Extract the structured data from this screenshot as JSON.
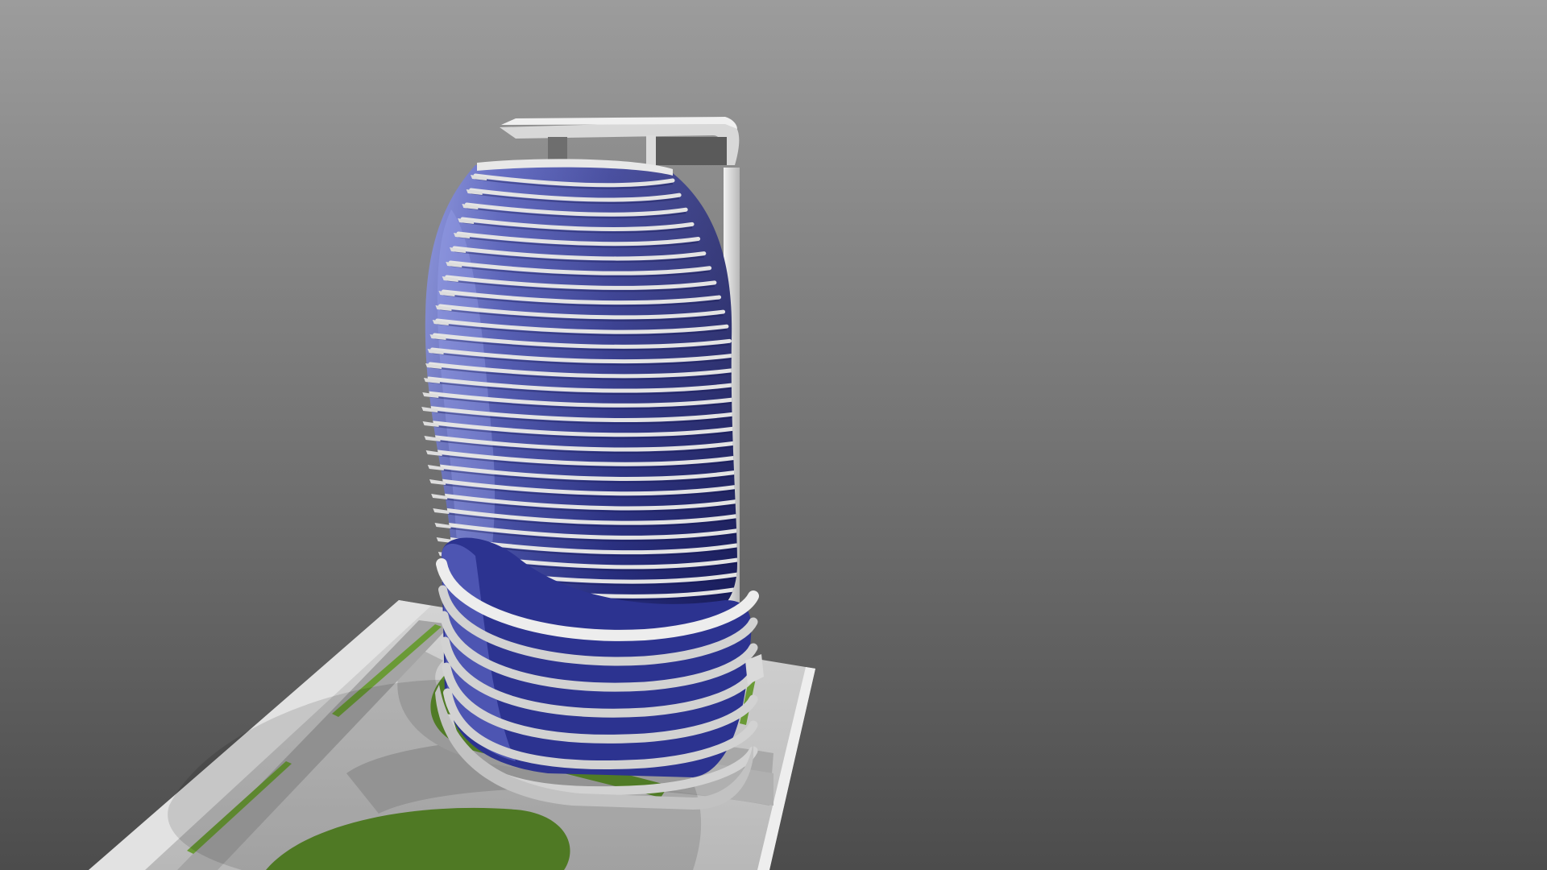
{
  "scene": {
    "subject": "tower-model",
    "colors": {
      "background_top": "#9a9a9a",
      "background_bottom": "#4e4e4e",
      "glass_light": "#5a64c8",
      "glass_dark": "#1e2270",
      "fins": "#e6e6e6",
      "site": "#c8c8c8",
      "lawn": "#5c8a2c",
      "road": "#9a9a9a"
    },
    "facade_fin_count": 30,
    "podium_fin_count": 7
  }
}
